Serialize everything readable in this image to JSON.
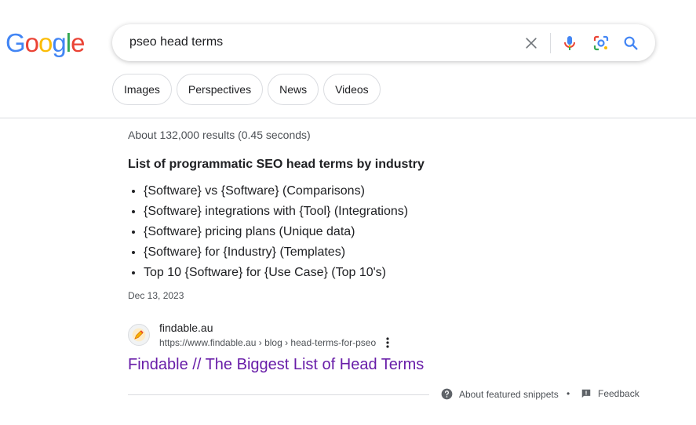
{
  "logo": {
    "letters": [
      "G",
      "o",
      "o",
      "g",
      "l",
      "e"
    ],
    "colors": [
      "#4285F4",
      "#EA4335",
      "#FBBC05",
      "#4285F4",
      "#34A853",
      "#EA4335"
    ]
  },
  "search": {
    "query": "pseo head terms",
    "clear_icon": "close-icon",
    "voice_icon": "mic-icon",
    "lens_icon": "camera-lens-icon",
    "submit_icon": "search-icon"
  },
  "chips": [
    "Images",
    "Perspectives",
    "News",
    "Videos"
  ],
  "stats": "About 132,000 results (0.45 seconds)",
  "featured_snippet": {
    "title": "List of programmatic SEO head terms by industry",
    "items": [
      "{Software} vs {Software} (Comparisons)",
      "{Software} integrations with {Tool} (Integrations)",
      "{Software} pricing plans (Unique data)",
      "{Software} for {Industry} (Templates)",
      "Top 10 {Software} for {Use Case} (Top 10's)"
    ],
    "date": "Dec 13, 2023"
  },
  "result": {
    "site_name": "findable.au",
    "url": "https://www.findable.au › blog › head-terms-for-pseo",
    "title": "Findable // The Biggest List of Head Terms",
    "title_color": "#681da8"
  },
  "footer": {
    "about": "About featured snippets",
    "separator": "•",
    "feedback": "Feedback"
  }
}
